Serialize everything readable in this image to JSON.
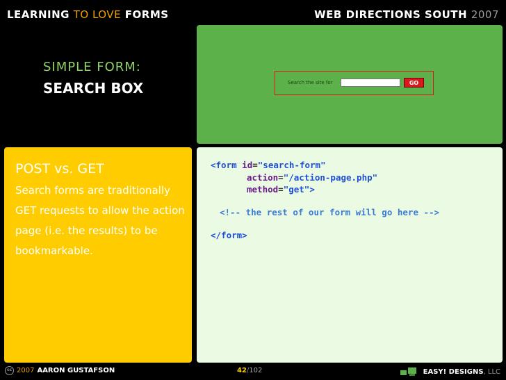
{
  "header": {
    "left": {
      "part1": "LEARNING",
      "part2": "TO LOVE",
      "part3": "FORMS"
    },
    "right": {
      "part1": "WEB DIRECTIONS SOUTH",
      "part2": "2007"
    }
  },
  "slide_title": {
    "line1": "SIMPLE FORM:",
    "line2": "SEARCH BOX"
  },
  "example_form": {
    "label": "Search the site for",
    "field_value": "",
    "button_label": "GO"
  },
  "info_panel": {
    "heading": "POST vs. GET",
    "body": "Search forms are traditionally GET requests to allow the action page (i.e. the results) to be bookmarkable."
  },
  "code": {
    "open_tag": "<form",
    "id_attr": "id",
    "id_value": "\"search-form\"",
    "action_attr": "action",
    "action_value": "\"/action-page.php\"",
    "method_attr": "method",
    "method_value": "\"get\"",
    "tag_close": ">",
    "comment": "<!-- the rest of our form will go here -->",
    "close_tag": "</form>"
  },
  "footer": {
    "cc_symbol": "cc",
    "year": "2007",
    "author": "AARON GUSTAFSON",
    "page_current": "42",
    "page_separator": "/",
    "page_total": "102",
    "company": "EASY! DESIGNS",
    "company_suffix": ", LLC"
  },
  "colors": {
    "accent_yellow": "#ffcc00",
    "accent_green": "#5db14a",
    "code_bg": "#ebfbe3",
    "title_green": "#8fd36a"
  }
}
